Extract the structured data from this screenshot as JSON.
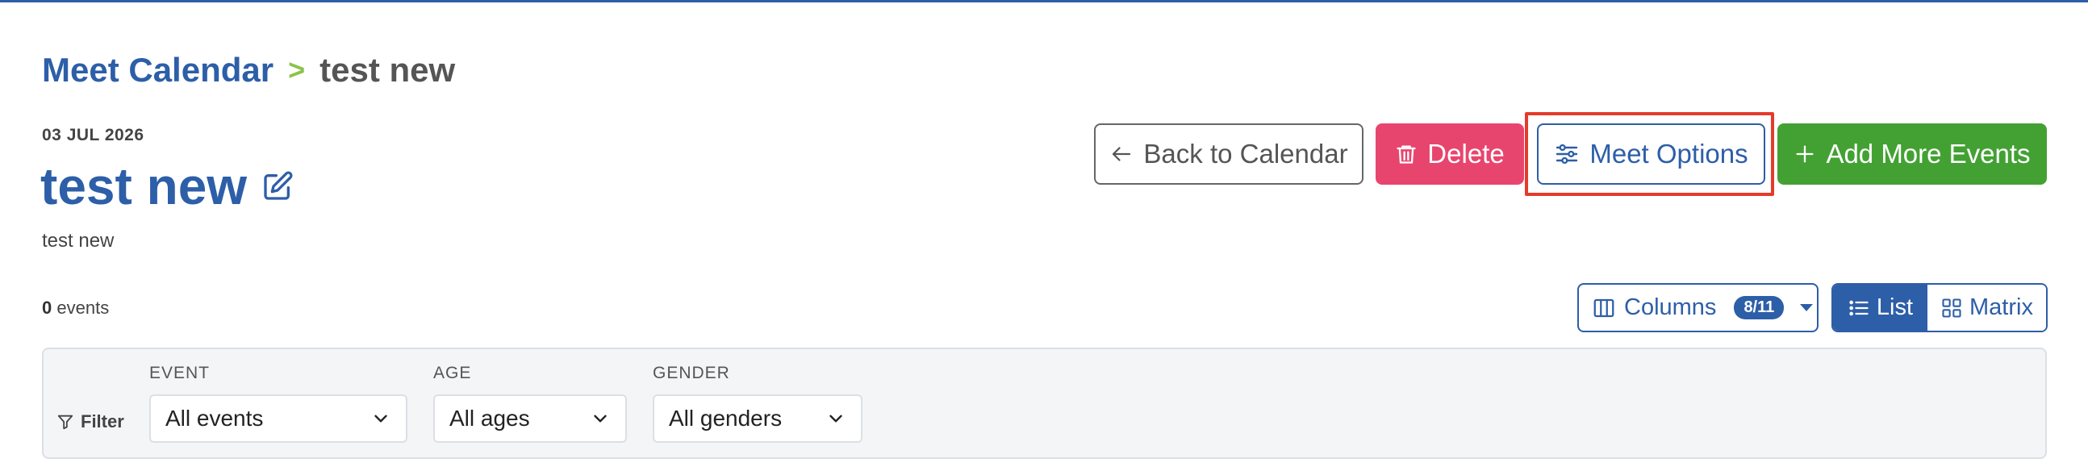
{
  "breadcrumb": {
    "parent": "Meet Calendar",
    "separator": ">",
    "current": "test new"
  },
  "meet": {
    "date": "03 JUL 2026",
    "title": "test new",
    "description": "test new"
  },
  "actions": {
    "back": "Back to Calendar",
    "delete": "Delete",
    "options": "Meet Options",
    "add": "Add More Events"
  },
  "events": {
    "count": "0",
    "label": "events"
  },
  "columns": {
    "label": "Columns",
    "badge": "8/11"
  },
  "view_toggle": {
    "list": "List",
    "matrix": "Matrix",
    "active": "List"
  },
  "filters": {
    "label": "Filter",
    "event": {
      "caption": "EVENT",
      "value": "All events"
    },
    "age": {
      "caption": "AGE",
      "value": "All ages"
    },
    "gender": {
      "caption": "GENDER",
      "value": "All genders"
    }
  },
  "colors": {
    "primary": "#2d5ea8",
    "danger": "#e8456e",
    "success": "#43a133",
    "separator": "#8bc34a",
    "highlight": "#e53b2b"
  },
  "icons": [
    "arrow-left-icon",
    "trash-icon",
    "sliders-icon",
    "plus-icon",
    "edit-icon",
    "columns-icon",
    "list-icon",
    "grid-icon",
    "filter-icon",
    "chevron-down-icon"
  ]
}
